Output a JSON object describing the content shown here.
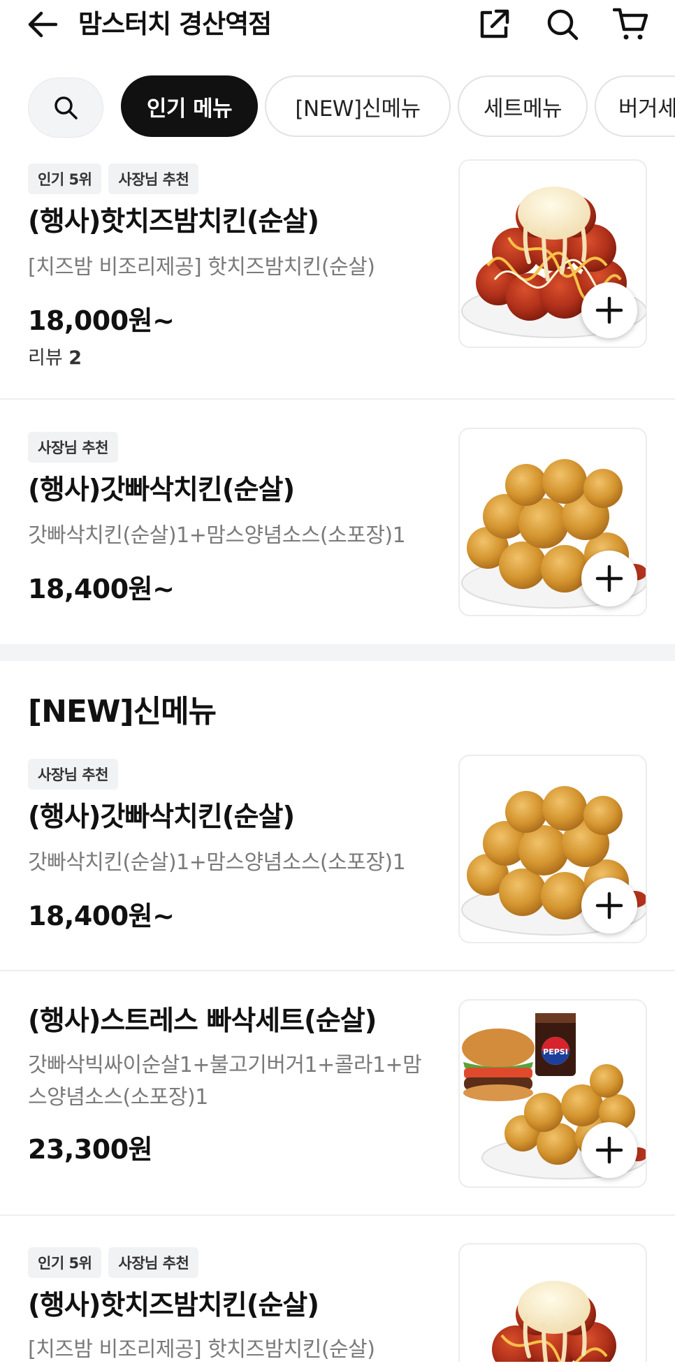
{
  "header": {
    "title": "맘스터치 경산역점",
    "back_icon": "arrow-left-icon",
    "share_icon": "share-icon",
    "search_icon": "search-icon",
    "cart_icon": "cart-icon"
  },
  "tabs": {
    "search_icon": "search-icon",
    "items": [
      {
        "label": "인기 메뉴",
        "active": true
      },
      {
        "label": "[NEW]신메뉴",
        "active": false
      },
      {
        "label": "세트메뉴",
        "active": false
      },
      {
        "label": "버거세",
        "active": false
      }
    ]
  },
  "popular": {
    "items": [
      {
        "badges": [
          "인기 5위",
          "사장님 추천"
        ],
        "name": "(행사)핫치즈밤치킨(순살)",
        "desc": "[치즈밤 비조리제공] 핫치즈밤치킨(순살)",
        "price": "18,000원~",
        "review_label": "리뷰",
        "review_count": "2"
      },
      {
        "badges": [
          "사장님 추천"
        ],
        "name": "(행사)갓빠삭치킨(순살)",
        "desc": "갓빠삭치킨(순살)1+맘스양념소스(소포장)1",
        "price": "18,400원~"
      }
    ]
  },
  "new_section": {
    "title": "[NEW]신메뉴",
    "items": [
      {
        "badges": [
          "사장님 추천"
        ],
        "name": "(행사)갓빠삭치킨(순살)",
        "desc": "갓빠삭치킨(순살)1+맘스양념소스(소포장)1",
        "price": "18,400원~"
      },
      {
        "name": "(행사)스트레스 빠삭세트(순살)",
        "desc_line1": "갓빠삭빅싸이순살1+불고기버거1+콜라1+맘",
        "desc_line2": "스양념소스(소포장)1",
        "price": "23,300원",
        "drink_brand": "PEPSI"
      },
      {
        "badges": [
          "인기 5위",
          "사장님 추천"
        ],
        "name": "(행사)핫치즈밤치킨(순살)",
        "desc": "[치즈밤 비조리제공] 핫치즈밤치킨(순살)"
      }
    ]
  },
  "colors": {
    "accent_dark": "#111111",
    "badge_bg": "#f1f2f4",
    "desc_gray": "#7a7a7a",
    "chicken_fried": "#d49a3a",
    "chicken_spicy": "#b3321c"
  },
  "add_icon": "plus-icon"
}
